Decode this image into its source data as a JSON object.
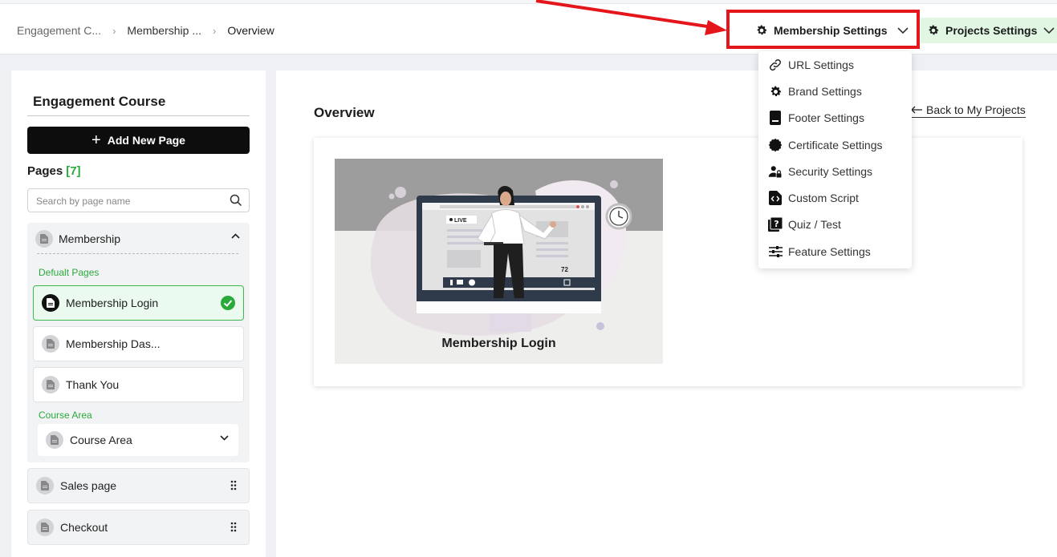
{
  "breadcrumb": {
    "items": [
      "Engagement C...",
      "Membership ...",
      "Overview"
    ]
  },
  "header": {
    "membership_settings_label": "Membership Settings",
    "projects_settings_label": "Projects Settings"
  },
  "dropdown": {
    "items": [
      {
        "label": "URL Settings",
        "icon": "link-icon"
      },
      {
        "label": "Brand Settings",
        "icon": "gear-icon"
      },
      {
        "label": "Footer Settings",
        "icon": "footer-icon"
      },
      {
        "label": "Certificate Settings",
        "icon": "badge-icon"
      },
      {
        "label": "Security Settings",
        "icon": "user-lock-icon"
      },
      {
        "label": "Custom Script",
        "icon": "code-icon"
      },
      {
        "label": "Quiz / Test",
        "icon": "question-icon"
      },
      {
        "label": "Feature Settings",
        "icon": "sliders-icon"
      }
    ]
  },
  "sidebar": {
    "title": "Engagement Course",
    "add_button_label": "Add New Page",
    "pages_label": "Pages",
    "pages_count": "[7]",
    "search_placeholder": "Search by page name",
    "group": {
      "name": "Membership",
      "default_pages_label": "Defualt Pages",
      "pages": [
        "Membership Login",
        "Membership Das...",
        "Thank You"
      ],
      "course_area_label": "Course Area",
      "course_area_item": "Course Area"
    },
    "other_pages": [
      "Sales page",
      "Checkout"
    ]
  },
  "main": {
    "title": "Overview",
    "back_link": "Back to My Projects",
    "card_label": "Membership Login",
    "thumb_live": "LIVE",
    "thumb_viewers": "72"
  },
  "colors": {
    "accent_green": "#2aaa3b",
    "highlight_red": "#e4161b",
    "projects_bg": "#e1f6e3"
  }
}
